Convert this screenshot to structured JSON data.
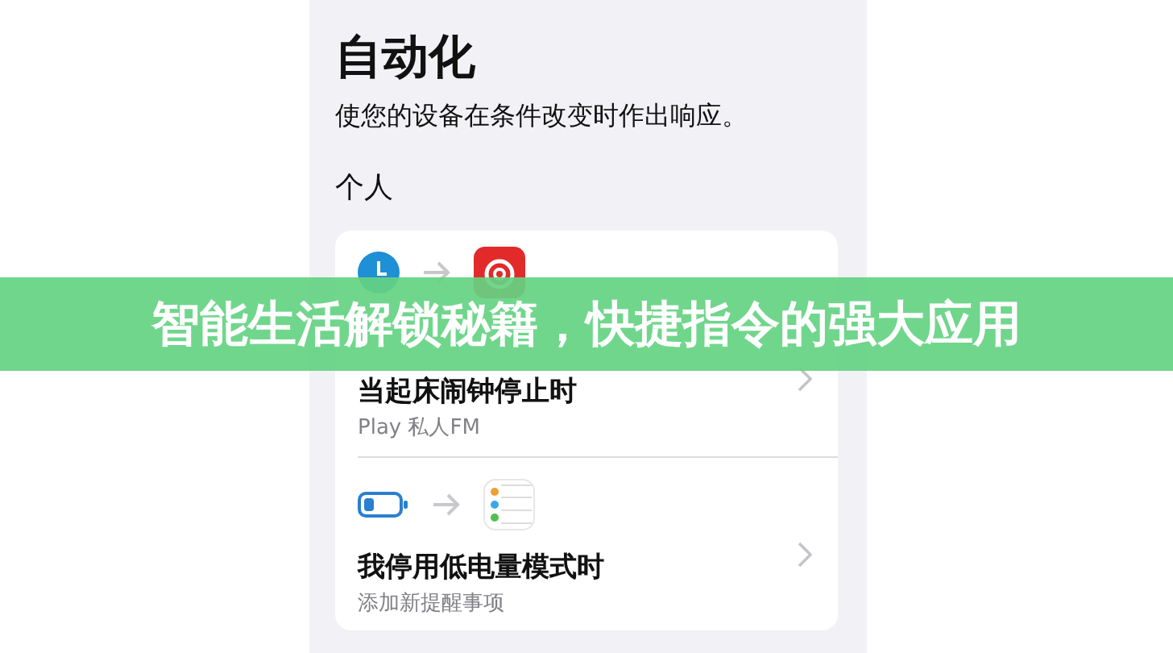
{
  "title": "自动化",
  "subtitle": "使您的设备在条件改变时作出响应。",
  "section": "个人",
  "automations": [
    {
      "title": "当起床闹钟停止时",
      "detail": "Play 私人FM"
    },
    {
      "title": "我停用低电量模式时",
      "detail": "添加新提醒事项"
    }
  ],
  "banner": "智能生活解锁秘籍，快捷指令的强大应用"
}
